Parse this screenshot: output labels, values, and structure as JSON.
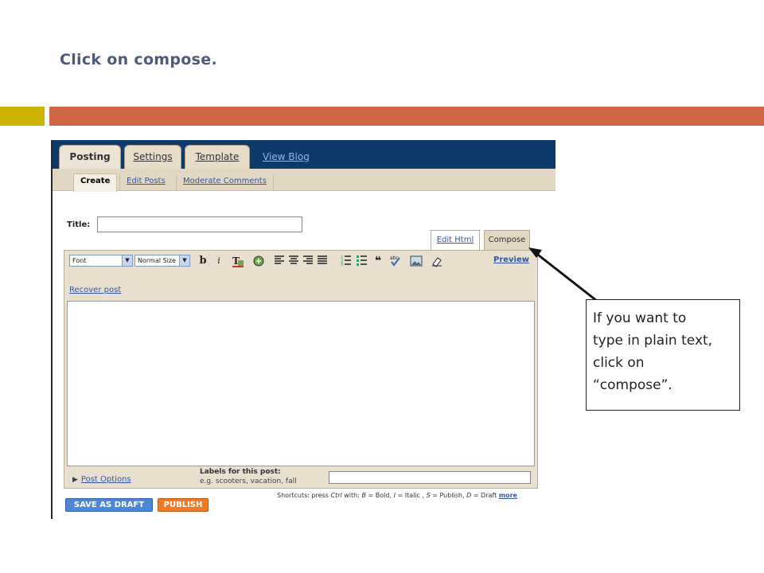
{
  "slide": {
    "title": "Click on compose.",
    "colors": {
      "gold": "#c9b200",
      "rust": "#cf6447"
    }
  },
  "blogger": {
    "tabs": [
      "Posting",
      "Settings",
      "Template"
    ],
    "view_blog": "View Blog",
    "subtabs": [
      "Create",
      "Edit Posts",
      "Moderate Comments"
    ],
    "title_label": "Title:",
    "mode_tabs": {
      "edit_html": "Edit Html",
      "compose": "Compose"
    },
    "toolbar": {
      "font": "Font",
      "size": "Normal Size",
      "preview": "Preview",
      "icons": [
        "bold-icon",
        "italic-icon",
        "text-color-icon",
        "link-icon",
        "align-left-icon",
        "align-center-icon",
        "align-right-icon",
        "justify-icon",
        "numbered-list-icon",
        "bullet-list-icon",
        "blockquote-icon",
        "spellcheck-icon",
        "image-icon",
        "clear-format-icon"
      ]
    },
    "recover_post": "Recover post",
    "post_options": "Post Options",
    "labels_title": "Labels for this post:",
    "labels_hint": "e.g. scooters, vacation, fall",
    "shortcuts": {
      "prefix": "Shortcuts: press",
      "ctrl": "Ctrl",
      "with": "with:",
      "b": "B",
      "bold": "= Bold,",
      "i": "I",
      "italic": "= Italic ,",
      "s": "S",
      "publish": "= Publish,",
      "d": "D",
      "draft": "= Draft",
      "more": "more"
    },
    "buttons": {
      "save_draft": "SAVE AS DRAFT",
      "publish": "PUBLISH"
    }
  },
  "callout": {
    "line1": "If you want to",
    "line2": "type in plain text,",
    "line3": "click on",
    "line4": "“compose”."
  }
}
